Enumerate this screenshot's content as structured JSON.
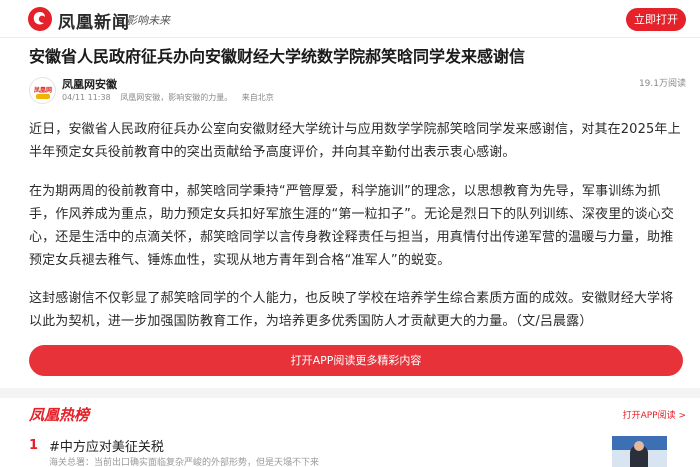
{
  "header": {
    "brand": "凤凰新闻",
    "slogan": "影响未来",
    "open_button": "立即打开",
    "logo_icon": "phoenix-logo-icon"
  },
  "article": {
    "title": "安徽省人民政府征兵办向安徽财经大学统数学院郝笑晗同学发来感谢信",
    "author": "凤凰网安徽",
    "date": "04/11 11:38",
    "source": "凤凰网安徽，影响安徽的力量。",
    "location": "来自北京",
    "views": "19.1万阅读",
    "paragraphs": [
      "近日，安徽省人民政府征兵办公室向安徽财经大学统计与应用数学学院郝笑晗同学发来感谢信，对其在2025年上半年预定女兵役前教育中的突出贡献给予高度评价，并向其辛勤付出表示衷心感谢。",
      "在为期两周的役前教育中，郝笑晗同学秉持“严管厚爱，科学施训”的理念，以思想教育为先导，军事训练为抓手，作风养成为重点，助力预定女兵扣好军旅生涯的“第一粒扣子”。无论是烈日下的队列训练、深夜里的谈心交心，还是生活中的点滴关怀，郝笑晗同学以言传身教诠释责任与担当，用真情付出传递军营的温暖与力量，助推预定女兵褪去稚气、锤炼血性，实现从地方青年到合格“准军人”的蜕变。",
      "这封感谢信不仅彰显了郝笑晗同学的个人能力，也反映了学校在培养学生综合素质方面的成效。安徽财经大学将以此为契机，进一步加强国防教育工作，为培养更多优秀国防人才贡献更大的力量。（文/吕晨露）"
    ],
    "read_more": "打开APP阅读更多精彩内容"
  },
  "hot": {
    "logo": "凤凰热榜",
    "open_link": "打开APP阅读 >",
    "items": [
      {
        "rank": "1",
        "title": "#中方应对美征关税",
        "subtitle": "海关总署：当前出口确实面临复杂严峻的外部形势，但是天塌不下来"
      }
    ]
  },
  "colors": {
    "brand_red": "#e5212a",
    "text": "#2a2a2a",
    "muted": "#8a8a8a"
  }
}
